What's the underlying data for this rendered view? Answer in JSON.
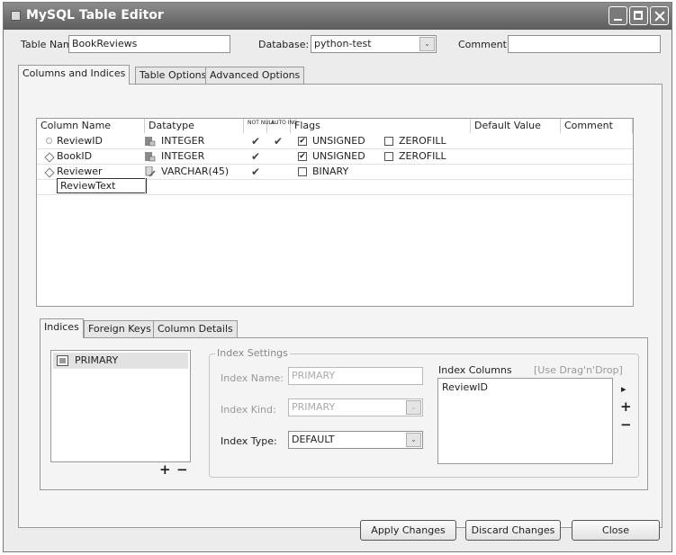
{
  "window": {
    "title": "MySQL Table Editor"
  },
  "header": {
    "table_name_label": "Table Name:",
    "table_name_value": "BookReviews",
    "database_label": "Database:",
    "database_value": "python-test",
    "comment_label": "Comment:",
    "comment_value": ""
  },
  "tabs": [
    {
      "label": "Columns and Indices"
    },
    {
      "label": "Table Options"
    },
    {
      "label": "Advanced Options"
    }
  ],
  "columns_grid": {
    "headers": [
      "Column Name",
      "Datatype",
      "NOT NULL",
      "AUTO INC",
      "Flags",
      "Default Value",
      "Comment"
    ],
    "rows": [
      {
        "name": "ReviewID",
        "datatype": "INTEGER",
        "not_null": true,
        "auto_inc": true,
        "flags": [
          {
            "label": "UNSIGNED",
            "checked": true
          },
          {
            "label": "ZEROFILL",
            "checked": false
          }
        ],
        "icon": "key-icon"
      },
      {
        "name": "BookID",
        "datatype": "INTEGER",
        "not_null": true,
        "auto_inc": false,
        "flags": [
          {
            "label": "UNSIGNED",
            "checked": true
          },
          {
            "label": "ZEROFILL",
            "checked": false
          }
        ],
        "icon": "diamond-icon"
      },
      {
        "name": "Reviewer",
        "datatype": "VARCHAR(45)",
        "not_null": true,
        "auto_inc": false,
        "flags": [
          {
            "label": "BINARY",
            "checked": false
          }
        ],
        "icon": "diamond-icon"
      }
    ],
    "editing_value": "ReviewText",
    "check_glyph": "✔",
    "checked_glyph": "✔"
  },
  "sub_tabs": [
    {
      "label": "Indices"
    },
    {
      "label": "Foreign Keys"
    },
    {
      "label": "Column Details"
    }
  ],
  "indices": {
    "list": [
      {
        "name": "PRIMARY"
      }
    ],
    "add_symbol": "+",
    "remove_symbol": "−",
    "settings_title": "Index Settings",
    "index_name_label": "Index Name:",
    "index_name_value": "PRIMARY",
    "index_kind_label": "Index Kind:",
    "index_kind_value": "PRIMARY",
    "index_type_label": "Index Type:",
    "index_type_value": "DEFAULT",
    "index_columns_label": "Index Columns",
    "drag_hint": "[Use Drag'n'Drop]",
    "index_columns": [
      "ReviewID"
    ],
    "col_add_symbol": "+",
    "col_remove_symbol": "−",
    "col_move_symbol": "▸"
  },
  "buttons": {
    "apply": "Apply Changes",
    "discard": "Discard Changes",
    "close": "Close"
  },
  "combo_arrow": "⌄"
}
